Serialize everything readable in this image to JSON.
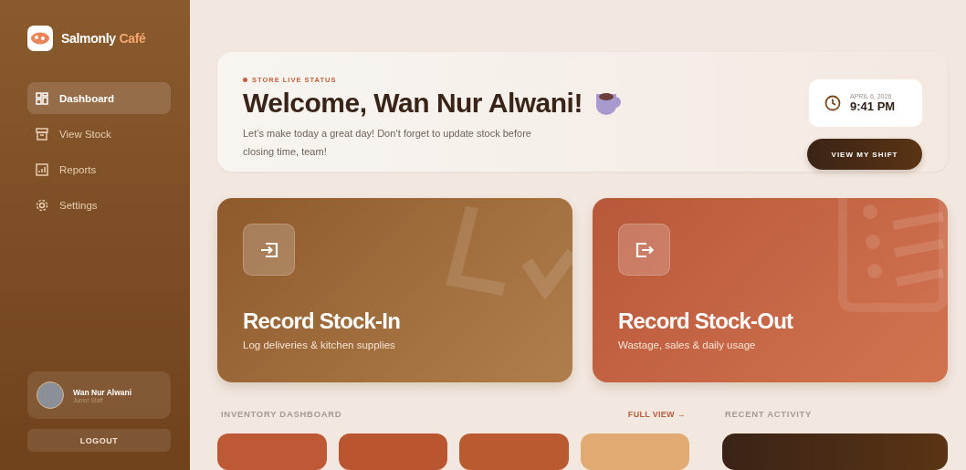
{
  "brand": {
    "name": "Salmonly",
    "accent": "Café"
  },
  "sidebar": {
    "items": [
      {
        "label": "Dashboard",
        "kind": "grid",
        "selected": true
      },
      {
        "label": "View Stock",
        "kind": "box",
        "selected": false
      },
      {
        "label": "Reports",
        "kind": "chart",
        "selected": false
      },
      {
        "label": "Settings",
        "kind": "gear",
        "selected": false
      }
    ]
  },
  "user": {
    "name": "Wan Nur Alwani",
    "role": "Junior Staff"
  },
  "logout": "LOGOUT",
  "hero": {
    "status": "STORE LIVE STATUS",
    "title": "Welcome, Wan Nur Alwani!",
    "message": "Let’s make today a great day! Don’t forget to update stock before closing time, team!",
    "date": "APRIL 6, 2026",
    "time": "9:41 PM",
    "button": "VIEW MY SHIFT"
  },
  "actions": [
    {
      "kind": "in",
      "title": "Record Stock-In",
      "subtitle": "Log deliveries & kitchen supplies"
    },
    {
      "kind": "out",
      "title": "Record Stock-Out",
      "subtitle": "Wastage, sales & daily usage"
    }
  ],
  "inventory": {
    "heading": "INVENTORY DASHBOARD",
    "link": "FULL VIEW →",
    "tiles": [
      {
        "color": "#bd5a35"
      },
      {
        "color": "#b9552f"
      },
      {
        "color": "#b95a31"
      },
      {
        "color": "#e0aa72"
      }
    ]
  },
  "activity": {
    "heading": "RECENT ACTIVITY"
  }
}
